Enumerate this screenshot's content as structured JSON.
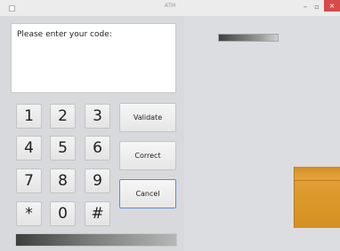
{
  "window": {
    "title": "ATM",
    "controls": {
      "minimize": "–",
      "maximize": "▫",
      "close": "×"
    }
  },
  "display": {
    "prompt": "Please enter your code:"
  },
  "keypad": {
    "keys": [
      "1",
      "2",
      "3",
      "4",
      "5",
      "6",
      "7",
      "8",
      "9",
      "*",
      "0",
      "#"
    ]
  },
  "actions": {
    "validate": "Validate",
    "correct": "Correct",
    "cancel": "Cancel"
  },
  "colors": {
    "cash_tray": "#de9a2e",
    "close_button": "#d64a4a",
    "panel_background": "#dcdde1"
  }
}
